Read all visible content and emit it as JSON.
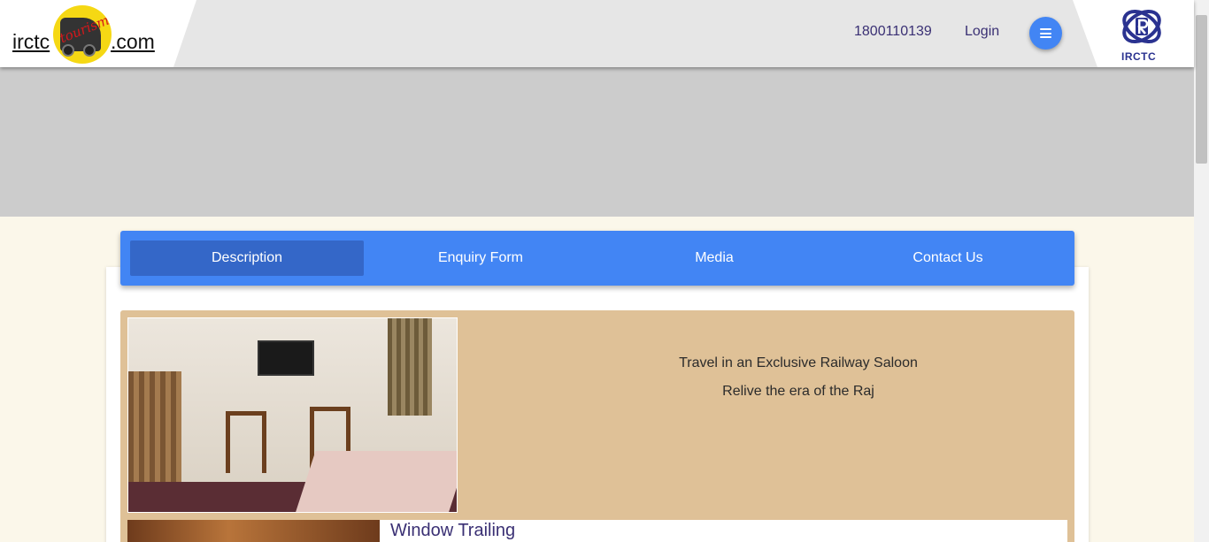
{
  "header": {
    "logo_left": "irctc",
    "logo_right": ".com",
    "logo_script": "tourism",
    "phone": "1800110139",
    "login": "Login",
    "menu_icon": "hamburger-icon",
    "brand_label": "IRCTC"
  },
  "tabs": [
    {
      "label": "Description",
      "active": true
    },
    {
      "label": "Enquiry Form",
      "active": false
    },
    {
      "label": "Media",
      "active": false
    },
    {
      "label": "Contact Us",
      "active": false
    }
  ],
  "description": {
    "tagline_1": "Travel in an Exclusive Railway Saloon",
    "tagline_2": "Relive the era of the Raj",
    "next_section_title": "Window Trailing"
  },
  "colors": {
    "accent": "#4285f4",
    "active_tab": "#3467c8",
    "panel": "#dfc197",
    "text_dark_blue": "#3a3074"
  }
}
